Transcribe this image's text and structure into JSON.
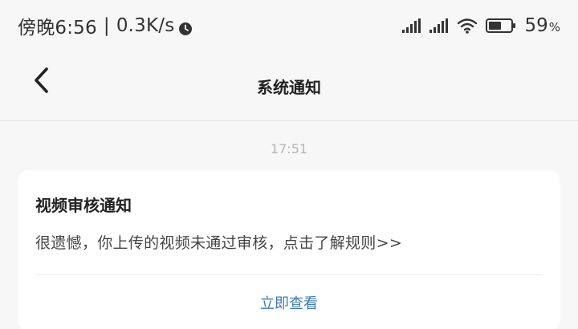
{
  "status_bar": {
    "carrier_time": "傍晚6:56",
    "separator": "|",
    "net_speed": "0.3K/s",
    "battery_value": "59",
    "battery_unit": "%",
    "battery_level": 0.59,
    "icons": [
      "clock-icon",
      "signal-icon",
      "signal-icon",
      "wifi-icon",
      "battery-icon"
    ]
  },
  "nav": {
    "title": "系统通知",
    "back_icon": "chevron-left-icon"
  },
  "message": {
    "time": "17:51",
    "title": "视频审核通知",
    "body": "很遗憾，你上传的视频未通过审核，点击了解规则>>",
    "action_label": "立即查看"
  },
  "colors": {
    "background": "#f7f7f7",
    "card": "#ffffff",
    "link": "#3e7cb3",
    "timestamp": "#b5b5b5"
  }
}
